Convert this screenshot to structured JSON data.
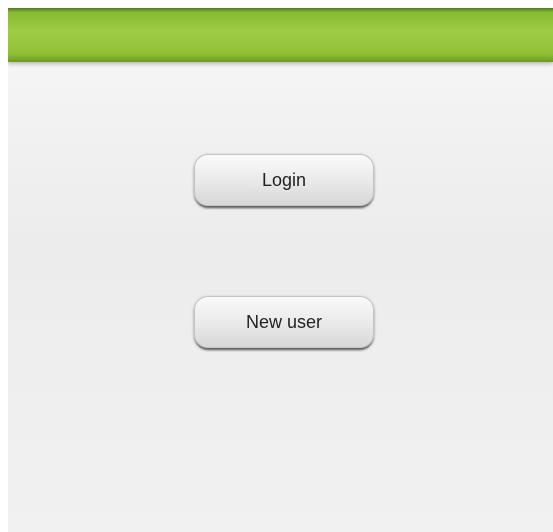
{
  "colors": {
    "action_bar": "#9fcd46",
    "background": "#eeeeee",
    "button_text": "#222222"
  },
  "buttons": {
    "login_label": "Login",
    "new_user_label": "New user"
  }
}
